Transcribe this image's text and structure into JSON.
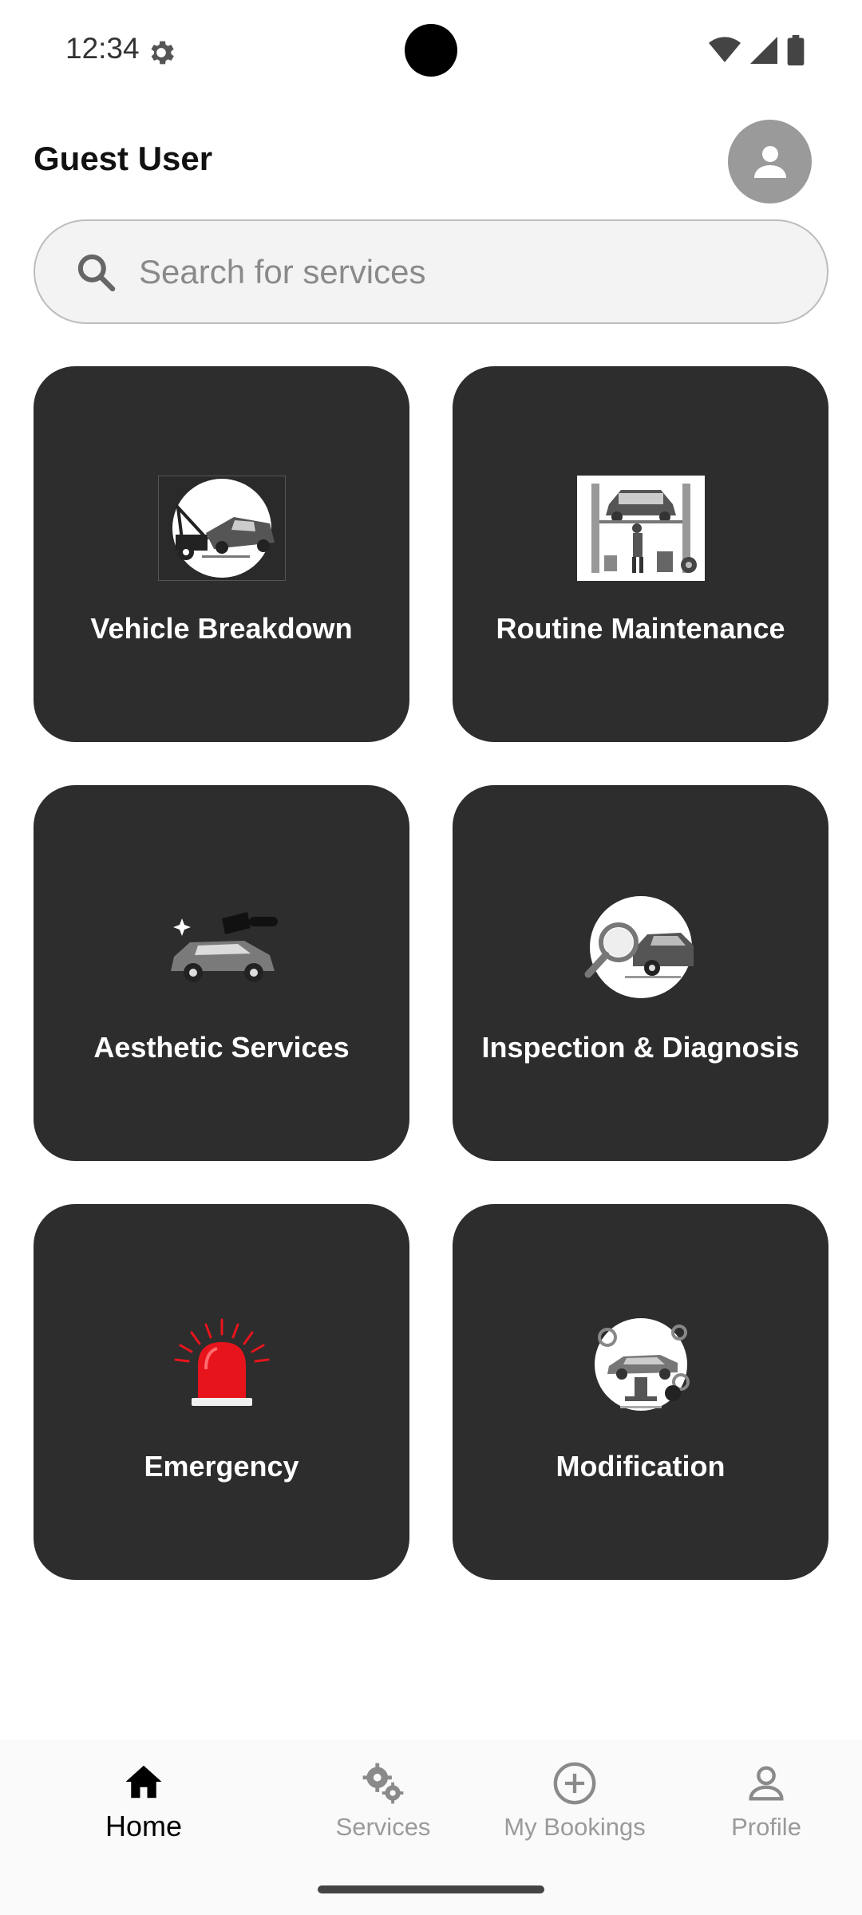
{
  "status_bar": {
    "time": "12:34",
    "icons": [
      "settings-gear-icon",
      "wifi-icon",
      "cell-signal-icon",
      "battery-icon"
    ]
  },
  "header": {
    "user_name": "Guest User",
    "avatar_icon": "person-icon"
  },
  "search": {
    "placeholder": "Search for services",
    "value": "",
    "icon": "search-icon"
  },
  "services": [
    {
      "label": "Vehicle Breakdown",
      "icon": "tow-truck-icon"
    },
    {
      "label": "Routine Maintenance",
      "icon": "car-lift-icon"
    },
    {
      "label": "Aesthetic Services",
      "icon": "car-polish-icon"
    },
    {
      "label": "Inspection & Diagnosis",
      "icon": "magnifier-car-icon"
    },
    {
      "label": "Emergency",
      "icon": "siren-icon"
    },
    {
      "label": "Modification",
      "icon": "car-modification-icon"
    }
  ],
  "bottom_nav": {
    "items": [
      {
        "label": "Home",
        "icon": "home-icon",
        "active": true
      },
      {
        "label": "Services",
        "icon": "gears-icon",
        "active": false
      },
      {
        "label": "My Bookings",
        "icon": "add-circle-icon",
        "active": false
      },
      {
        "label": "Profile",
        "icon": "person-outline-icon",
        "active": false
      }
    ]
  },
  "colors": {
    "tile_background": "#2d2d2d",
    "tile_text": "#ffffff",
    "emergency_red": "#e8141c",
    "avatar_bg": "#9a9a9a"
  }
}
